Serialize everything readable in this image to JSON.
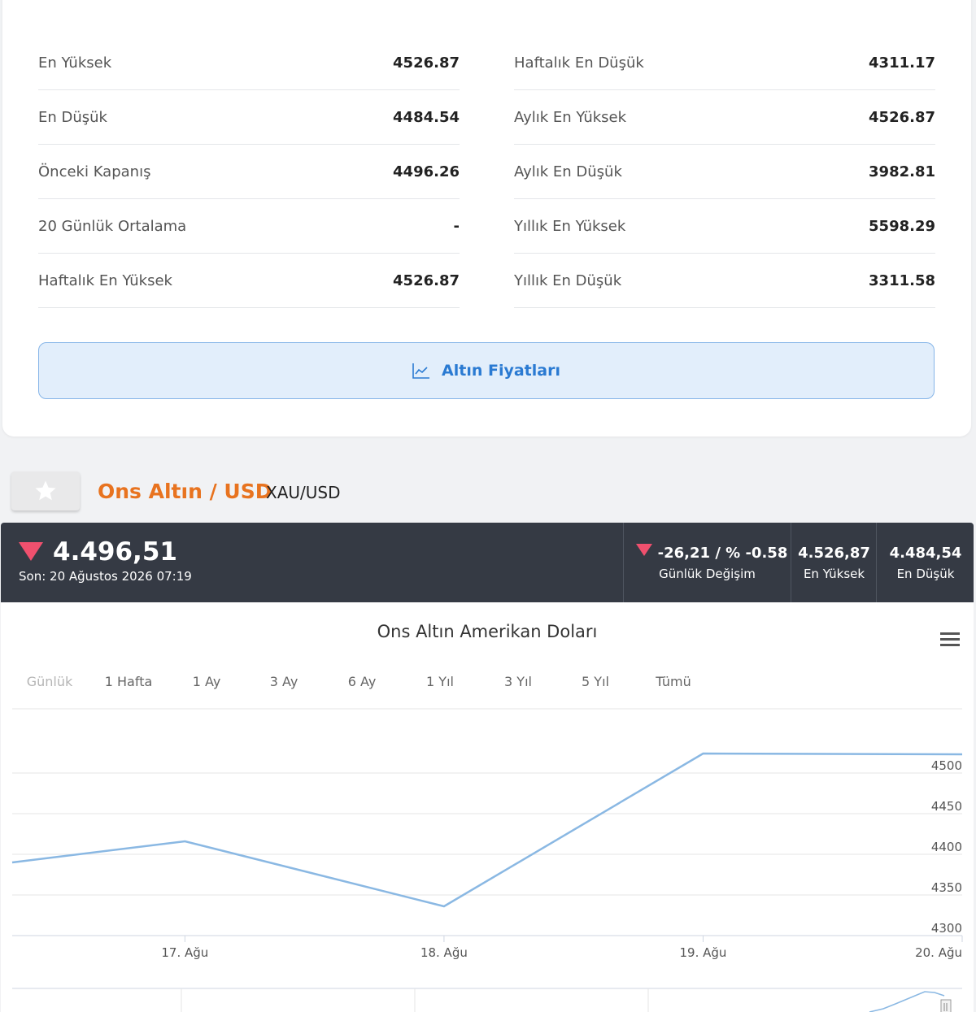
{
  "stats_left": [
    {
      "label": "En Yüksek",
      "value": "4526.87"
    },
    {
      "label": "En Düşük",
      "value": "4484.54"
    },
    {
      "label": "Önceki Kapanış",
      "value": "4496.26"
    },
    {
      "label": "20 Günlük Ortalama",
      "value": "-"
    },
    {
      "label": "Haftalık En Yüksek",
      "value": "4526.87"
    }
  ],
  "stats_right": [
    {
      "label": "Haftalık En Düşük",
      "value": "4311.17"
    },
    {
      "label": "Aylık En Yüksek",
      "value": "4526.87"
    },
    {
      "label": "Aylık En Düşük",
      "value": "3982.81"
    },
    {
      "label": "Yıllık En Yüksek",
      "value": "5598.29"
    },
    {
      "label": "Yıllık En Düşük",
      "value": "3311.58"
    }
  ],
  "gold_prices_button": {
    "label": "Altın Fiyatları"
  },
  "header": {
    "title": "Ons Altın / USD",
    "symbol": "XAU/USD"
  },
  "quote": {
    "price": "4.496,51",
    "last_update": "Son: 20 Ağustos 2026 07:19",
    "change_value": "-26,21 / % -0.58",
    "change_label": "Günlük Değişim",
    "high_value": "4.526,87",
    "high_label": "En Yüksek",
    "low_value": "4.484,54",
    "low_label": "En Düşük",
    "down_color": "#f0506e"
  },
  "chart": {
    "title": "Ons Altın Amerikan Doları",
    "range_tabs": [
      {
        "label": "Günlük",
        "disabled": true
      },
      {
        "label": "1 Hafta",
        "disabled": false
      },
      {
        "label": "1 Ay",
        "disabled": false
      },
      {
        "label": "3 Ay",
        "disabled": false
      },
      {
        "label": "6 Ay",
        "disabled": false
      },
      {
        "label": "1 Yıl",
        "disabled": false
      },
      {
        "label": "3 Yıl",
        "disabled": false
      },
      {
        "label": "5 Yıl",
        "disabled": false
      },
      {
        "label": "Tümü",
        "disabled": false
      }
    ]
  },
  "chart_data": {
    "type": "line",
    "title": "Ons Altın Amerikan Doları",
    "x_ticks": [
      "17. Ağu",
      "18. Ağu",
      "19. Ağu",
      "20. Ağu"
    ],
    "x_range": [
      "2026-08-16T08:00",
      "2026-08-20T00:00"
    ],
    "y_ticks": [
      4300,
      4350,
      4400,
      4450,
      4500
    ],
    "ylim": [
      4300,
      4520
    ],
    "grid": true,
    "series_color": "#8ab8e3",
    "points": [
      {
        "x": "2026-08-16T08:00",
        "y": 4390
      },
      {
        "x": "2026-08-17T00:00",
        "y": 4416
      },
      {
        "x": "2026-08-18T00:00",
        "y": 4336
      },
      {
        "x": "2026-08-19T00:00",
        "y": 4524
      },
      {
        "x": "2026-08-20T00:00",
        "y": 4523
      }
    ]
  }
}
